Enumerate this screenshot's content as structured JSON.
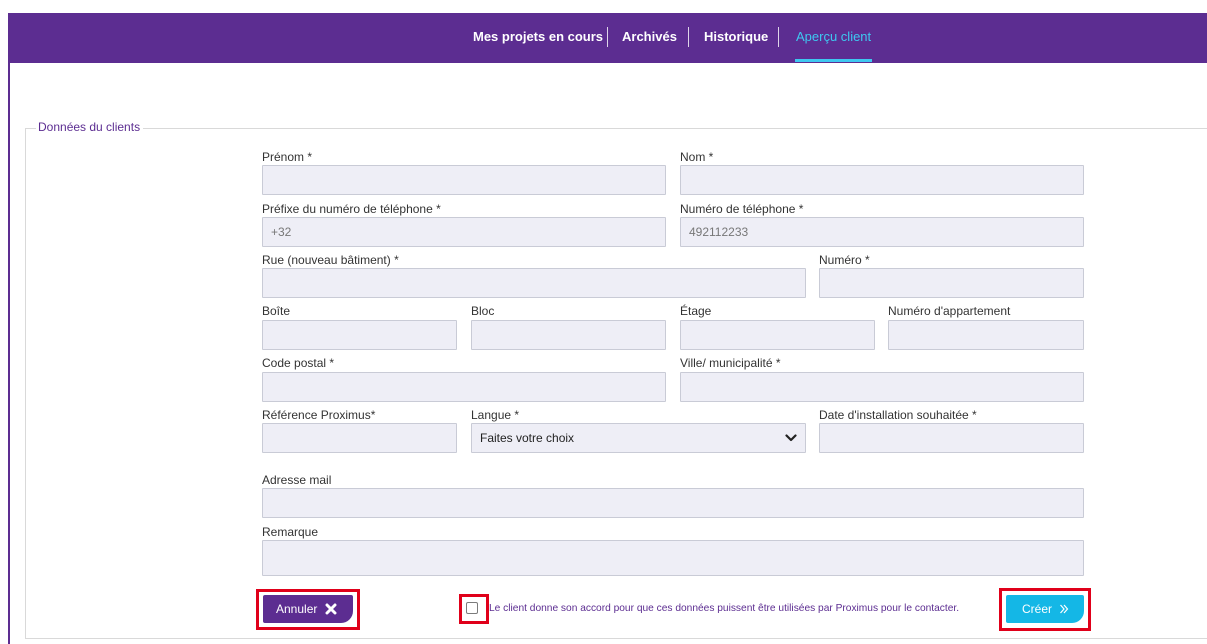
{
  "nav": {
    "items": [
      {
        "label": "Mes projets en cours",
        "active": false
      },
      {
        "label": "Archivés",
        "active": false
      },
      {
        "label": "Historique",
        "active": false
      },
      {
        "label": "Aperçu client",
        "active": true
      }
    ]
  },
  "form": {
    "legend": "Données du clients",
    "fields": {
      "prenom": {
        "label": "Prénom *",
        "value": ""
      },
      "nom": {
        "label": "Nom *",
        "value": ""
      },
      "phone_prefix": {
        "label": "Préfixe du numéro de téléphone *",
        "value": "+32"
      },
      "phone": {
        "label": "Numéro de téléphone *",
        "value": "492112233"
      },
      "rue": {
        "label": "Rue (nouveau bâtiment) *",
        "value": ""
      },
      "numero": {
        "label": "Numéro *",
        "value": ""
      },
      "boite": {
        "label": "Boîte",
        "value": ""
      },
      "bloc": {
        "label": "Bloc",
        "value": ""
      },
      "etage": {
        "label": "Étage",
        "value": ""
      },
      "appartement": {
        "label": "Numéro d'appartement",
        "value": ""
      },
      "code_postal": {
        "label": "Code postal *",
        "value": ""
      },
      "ville": {
        "label": "Ville/ municipalité *",
        "value": ""
      },
      "reference": {
        "label": "Référence Proximus*",
        "value": ""
      },
      "langue": {
        "label": "Langue *",
        "selected": "Faites votre choix"
      },
      "date": {
        "label": "Date d'installation souhaitée *",
        "value": ""
      },
      "mail": {
        "label": "Adresse mail",
        "value": ""
      },
      "remarque": {
        "label": "Remarque",
        "value": ""
      }
    }
  },
  "actions": {
    "cancel_label": "Annuler",
    "consent_text": "Le client donne son accord pour que ces données puissent être utilisées par Proximus pour le contacter.",
    "create_label": "Créer"
  },
  "colors": {
    "brand_purple": "#5c2d91",
    "accent_blue": "#14b7e6",
    "highlight_red": "#e0001a"
  },
  "icons": {
    "cancel": "close-x-icon",
    "create": "double-chevron-right-icon",
    "select": "chevron-down-icon"
  }
}
